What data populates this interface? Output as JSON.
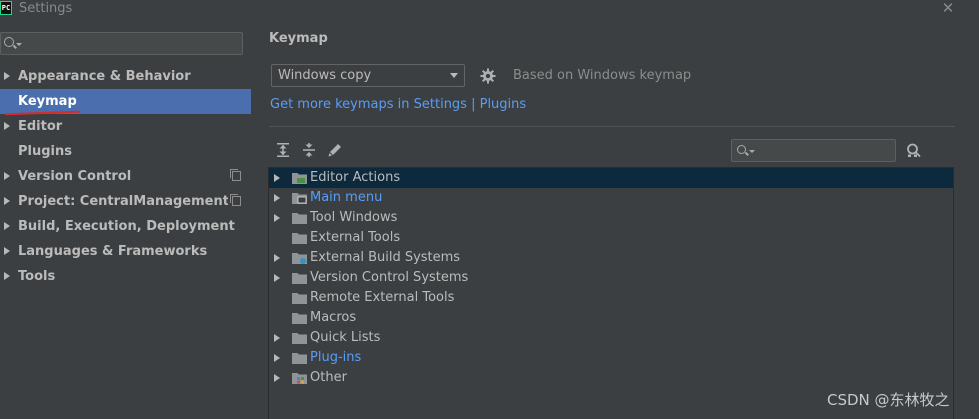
{
  "window": {
    "app_icon_text": "PC",
    "title": "Settings",
    "close_icon": "close-icon"
  },
  "sidebar": {
    "search_placeholder": "",
    "items": [
      {
        "label": "Appearance & Behavior",
        "expandable": true,
        "selected": false,
        "copy_icon": false
      },
      {
        "label": "Keymap",
        "expandable": false,
        "selected": true,
        "copy_icon": false
      },
      {
        "label": "Editor",
        "expandable": true,
        "selected": false,
        "copy_icon": false
      },
      {
        "label": "Plugins",
        "expandable": false,
        "selected": false,
        "copy_icon": false
      },
      {
        "label": "Version Control",
        "expandable": true,
        "selected": false,
        "copy_icon": true
      },
      {
        "label": "Project: CentralManagementSyst...",
        "expandable": true,
        "selected": false,
        "copy_icon": true
      },
      {
        "label": "Build, Execution, Deployment",
        "expandable": true,
        "selected": false,
        "copy_icon": false
      },
      {
        "label": "Languages & Frameworks",
        "expandable": true,
        "selected": false,
        "copy_icon": false
      },
      {
        "label": "Tools",
        "expandable": true,
        "selected": false,
        "copy_icon": false
      }
    ]
  },
  "main": {
    "title": "Keymap",
    "keymap_select_value": "Windows copy",
    "based_on": "Based on Windows keymap",
    "link_prefix": "Get more keymaps in Settings | Plugins",
    "toolbar": {
      "expand_all_icon": "expand-all-icon",
      "collapse_all_icon": "collapse-all-icon",
      "edit_icon": "pencil-icon",
      "find_shortcut_icon": "find-by-shortcut-icon",
      "filter_placeholder": ""
    },
    "tree": [
      {
        "label": "Editor Actions",
        "expandable": true,
        "selected": true,
        "link": false,
        "icon": "editor-actions-folder-icon"
      },
      {
        "label": "Main menu",
        "expandable": true,
        "selected": false,
        "link": true,
        "icon": "main-menu-folder-icon"
      },
      {
        "label": "Tool Windows",
        "expandable": true,
        "selected": false,
        "link": false,
        "icon": "folder-icon"
      },
      {
        "label": "External Tools",
        "expandable": false,
        "selected": false,
        "link": false,
        "icon": "folder-icon"
      },
      {
        "label": "External Build Systems",
        "expandable": true,
        "selected": false,
        "link": false,
        "icon": "build-systems-folder-icon"
      },
      {
        "label": "Version Control Systems",
        "expandable": true,
        "selected": false,
        "link": false,
        "icon": "folder-icon"
      },
      {
        "label": "Remote External Tools",
        "expandable": false,
        "selected": false,
        "link": false,
        "icon": "folder-icon"
      },
      {
        "label": "Macros",
        "expandable": false,
        "selected": false,
        "link": false,
        "icon": "folder-icon"
      },
      {
        "label": "Quick Lists",
        "expandable": true,
        "selected": false,
        "link": false,
        "icon": "folder-icon"
      },
      {
        "label": "Plug-ins",
        "expandable": true,
        "selected": false,
        "link": true,
        "icon": "folder-icon"
      },
      {
        "label": "Other",
        "expandable": true,
        "selected": false,
        "link": false,
        "icon": "other-folder-icon"
      }
    ]
  },
  "watermark": "CSDN @东林牧之",
  "colors": {
    "background": "#3c3f41",
    "selection_sidebar": "#4b6eaf",
    "selection_tree": "#0d293e",
    "link": "#589df6",
    "text": "#bbbbbb",
    "annotation_red": "#d62b2b"
  }
}
